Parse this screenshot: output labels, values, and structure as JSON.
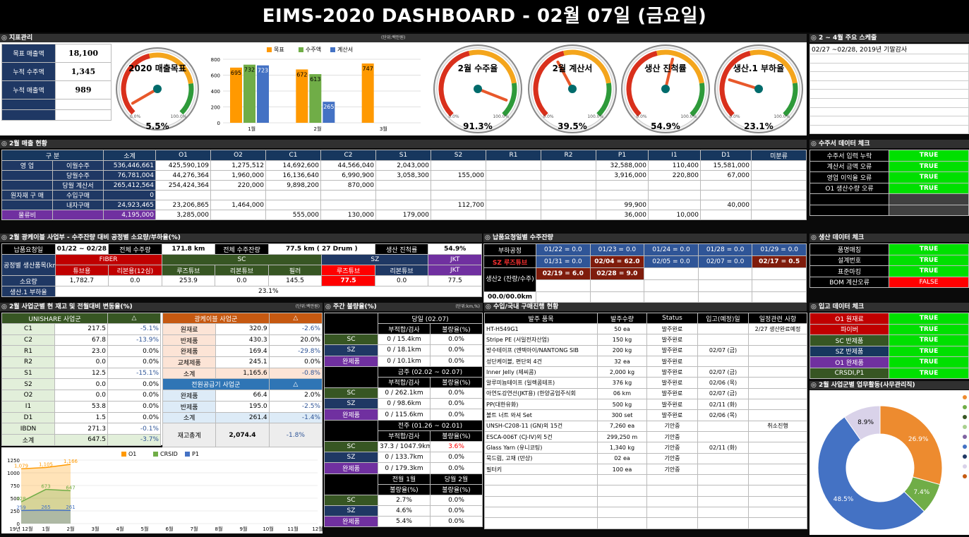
{
  "title": "EIMS-2020 DASHBOARD - 02월 07일 (금요일)",
  "sections": {
    "kpi": "◎ 지표관리",
    "schedule": "◎ 2 ~ 4월 주요 스케줄",
    "sales": "◎ 2월 매출 현황",
    "order_check": "◎ 수주서 데이터 체크",
    "cable": "◎ 2월 광케이블 사업부 - 수주잔량 대비 공정별 소요량/부하율(%)",
    "deadline": "◎ 납품요청일별 수주잔량",
    "prod_check": "◎ 생산 데이터 체크",
    "inventory": "◎ 2월 사업군별 현 재고 및 전월대비 변동율(%)",
    "defect": "◎ 주간 불량율(%)",
    "purchase": "◎ 수입/국내 구매진행 현황",
    "receipt_check": "◎ 입고 데이터 체크",
    "activity": "◎ 2월 사업군별 업무활동(사무관리직)"
  },
  "kpi": {
    "unit": "(단위:백만원)",
    "rows": [
      {
        "label": "목표 매출액",
        "value": "18,100"
      },
      {
        "label": "누적 수주액",
        "value": "1,345"
      },
      {
        "label": "누적 매출액",
        "value": "989"
      }
    ]
  },
  "gauges": [
    {
      "title": "2020 매출목표",
      "value": "5.5%",
      "pct": 5.5
    },
    {
      "title": "2월 수주율",
      "value": "91.3%",
      "pct": 91.3
    },
    {
      "title": "2월 계산서",
      "value": "39.5%",
      "pct": 39.5
    },
    {
      "title": "생산 진척률",
      "value": "54.9%",
      "pct": 54.9
    },
    {
      "title": "생산.1 부하율",
      "value": "23.1%",
      "pct": 23.1
    }
  ],
  "gauge_ticks": {
    "min": "0.0%",
    "max": "100.0%"
  },
  "chart_data": [
    {
      "type": "bar",
      "categories": [
        "1월",
        "2월",
        "3월"
      ],
      "series": [
        {
          "name": "목표",
          "color": "#ff9900",
          "values": [
            695,
            672,
            747
          ]
        },
        {
          "name": "수주액",
          "color": "#70ad47",
          "values": [
            732,
            613,
            null
          ]
        },
        {
          "name": "계산서",
          "color": "#4472c4",
          "values": [
            723,
            265,
            null
          ]
        }
      ],
      "ylim": [
        0,
        800
      ],
      "yticks": [
        "0",
        "200",
        "400",
        "600",
        "800"
      ]
    },
    {
      "type": "line",
      "categories": [
        "19년 12월",
        "1월",
        "2월",
        "3월",
        "4월",
        "5월",
        "6월",
        "7월",
        "8월",
        "9월",
        "10월",
        "11월",
        "12월"
      ],
      "series": [
        {
          "name": "O1",
          "color": "#ff9900",
          "values": [
            1079,
            1105,
            1166
          ]
        },
        {
          "name": "CRSID",
          "color": "#70ad47",
          "values": [
            428,
            673,
            647
          ]
        },
        {
          "name": "P1",
          "color": "#4472c4",
          "values": [
            259,
            265,
            261
          ]
        }
      ],
      "ylim": [
        0,
        1250
      ],
      "yticks": [
        "0",
        "250",
        "500",
        "750",
        "1000",
        "1250"
      ],
      "point_labels": [
        [
          "1,079",
          "1,105",
          "1,166"
        ],
        [
          "428",
          "673",
          "647"
        ],
        [
          "259",
          "265",
          "261"
        ]
      ]
    },
    {
      "type": "pie",
      "values": [
        26.9,
        7.4,
        48.5,
        8.9
      ],
      "labels": [
        "26.9%",
        "7.4%",
        "48.5%",
        "8.9%"
      ],
      "colors": [
        "#ed8b2f",
        "#70ad47",
        "#4472c4",
        "#d9d2e9"
      ]
    }
  ],
  "schedule": [
    "02/27 ~02/28, 2019년 기말감사",
    "",
    "",
    "",
    "",
    "",
    "",
    "",
    "",
    ""
  ],
  "sales": {
    "header": [
      "구 분",
      "소계",
      "O1",
      "O2",
      "C1",
      "C2",
      "S1",
      "S2",
      "R1",
      "R2",
      "P1",
      "I1",
      "D1",
      "미분류"
    ],
    "rows": [
      [
        "영 업",
        "이월수주",
        "536,446,661",
        "425,590,109",
        "1,275,512",
        "14,692,600",
        "44,566,040",
        "2,043,000",
        "",
        "",
        "",
        "32,588,000",
        "110,400",
        "15,581,000",
        ""
      ],
      [
        "",
        "당월수주",
        "76,781,004",
        "44,276,364",
        "1,960,000",
        "16,136,640",
        "6,990,900",
        "3,058,300",
        "155,000",
        "",
        "",
        "3,916,000",
        "220,800",
        "67,000",
        ""
      ],
      [
        "",
        "당월 계산서",
        "265,412,564",
        "254,424,364",
        "220,000",
        "9,898,200",
        "870,000",
        "",
        "",
        "",
        "",
        "",
        "",
        "",
        ""
      ],
      [
        "원자재 구 매",
        "수입구매",
        "0",
        "",
        "",
        "",
        "",
        "",
        "",
        "",
        "",
        "",
        "",
        "",
        ""
      ],
      [
        "",
        "내자구매",
        "24,923,465",
        "23,206,865",
        "1,464,000",
        "",
        "",
        "",
        "112,700",
        "",
        "",
        "99,900",
        "",
        "40,000",
        ""
      ],
      [
        "물류비",
        "",
        "4,195,000",
        "3,285,000",
        "",
        "555,000",
        "130,000",
        "179,000",
        "",
        "",
        "",
        "36,000",
        "10,000",
        "",
        ""
      ]
    ]
  },
  "order_check": [
    {
      "label": "수주서 입력 누락",
      "value": "TRUE"
    },
    {
      "label": "계산서 금액 오류",
      "value": "TRUE"
    },
    {
      "label": "영업 이익율 오류",
      "value": "TRUE"
    },
    {
      "label": "O1 생산수량 오류",
      "value": "TRUE"
    }
  ],
  "cable": {
    "r1": [
      "납품요청일",
      "01/22 ~ 02/28",
      "전체 수주량",
      "171.8 km",
      "전체 수주잔량",
      "77.5 km ( 27 Drum )",
      "생산 진척률",
      "54.9%"
    ],
    "groups": [
      "공정별 생산품목(km)",
      "FIBER",
      "SC",
      "SZ",
      "JKT"
    ],
    "items": [
      "튜브용",
      "리본용(12심)",
      "루즈튜브",
      "리본튜브",
      "필러",
      "루즈튜브",
      "리본튜브",
      "JKT"
    ],
    "usage_label": "소요량",
    "usage": [
      "1,782.7",
      "0.0",
      "253.9",
      "0.0",
      "145.5",
      "77.5",
      "0.0",
      "77.5"
    ],
    "load_label": "생산.1 부하율",
    "load": "23.1%"
  },
  "deadline": {
    "label1": "부하공정",
    "hl": "SZ 루즈튜브",
    "label2": "생산2 (잔량/수주)",
    "r1": [
      "01/22 = 0.0",
      "01/23 = 0.0",
      "01/24 = 0.0",
      "01/28 = 0.0",
      "01/29 = 0.0"
    ],
    "r2": [
      "01/31 = 0.0",
      "02/04 = 62.0",
      "02/05 = 0.0",
      "02/07 = 0.0",
      "02/17 = 0.5"
    ],
    "r3": [
      "02/19 = 6.0",
      "02/28 = 9.0"
    ],
    "foot": "00.0/00.0km"
  },
  "prod_check": [
    {
      "label": "품명매칭",
      "value": "TRUE"
    },
    {
      "label": "설계번호",
      "value": "TRUE"
    },
    {
      "label": "표준마킹",
      "value": "TRUE"
    },
    {
      "label": "BOM 계산오류",
      "value": "FALSE"
    }
  ],
  "inventory": {
    "unit": "(단위:백만원)",
    "left_head": [
      "UNISHARE 사업군",
      "△"
    ],
    "left": [
      [
        "C1",
        "217.5",
        "-5.1%"
      ],
      [
        "C2",
        "67.8",
        "-13.9%"
      ],
      [
        "R1",
        "23.0",
        "0.0%"
      ],
      [
        "R2",
        "0.0",
        "0.0%"
      ],
      [
        "S1",
        "12.5",
        "-15.1%"
      ],
      [
        "S2",
        "0.0",
        "0.0%"
      ],
      [
        "O2",
        "0.0",
        "0.0%"
      ],
      [
        "I1",
        "53.8",
        "0.0%"
      ],
      [
        "D1",
        "1.5",
        "0.0%"
      ],
      [
        "IBDN",
        "271.3",
        "-0.1%"
      ],
      [
        "소계",
        "647.5",
        "-3.7%"
      ]
    ],
    "mid_head": [
      "광케이블 사업군",
      "△"
    ],
    "mid": [
      [
        "원재료",
        "320.9",
        "-2.6%"
      ],
      [
        "반제품",
        "430.3",
        "20.0%"
      ],
      [
        "완제품",
        "169.4",
        "-29.8%"
      ],
      [
        "교체제품",
        "245.1",
        "0.0%"
      ],
      [
        "소계",
        "1,165.6",
        "-0.8%"
      ]
    ],
    "mid2_head": [
      "전원공급기 사업군",
      "△"
    ],
    "mid2": [
      [
        "완제품",
        "66.4",
        "2.0%"
      ],
      [
        "반제품",
        "195.0",
        "-2.5%"
      ],
      [
        "소계",
        "261.4",
        "-1.4%"
      ]
    ],
    "total": [
      "재고총계",
      "2,074.4",
      "-1.8%"
    ]
  },
  "defect": {
    "unit": "(단위:km,%)",
    "blocks": [
      {
        "title": "당일 (02.07)",
        "cols": [
          "부적합/검사",
          "불량율(%)"
        ],
        "rows": [
          [
            "SC",
            "0 / 15.4km",
            "0.0%"
          ],
          [
            "SZ",
            "0 / 18.1km",
            "0.0%"
          ],
          [
            "완제품",
            "0 / 10.1km",
            "0.0%"
          ]
        ]
      },
      {
        "title": "금주 (02.02 ~ 02.07)",
        "cols": [
          "부적합/검사",
          "불량율(%)"
        ],
        "rows": [
          [
            "SC",
            "0 / 262.1km",
            "0.0%"
          ],
          [
            "SZ",
            "0 / 98.6km",
            "0.0%"
          ],
          [
            "완제품",
            "0 / 115.6km",
            "0.0%"
          ]
        ]
      },
      {
        "title": "전주 (01.26 ~ 02.01)",
        "cols": [
          "부적합/검사",
          "불량율(%)"
        ],
        "rows": [
          [
            "SC",
            "37.3 / 1047.9km",
            "3.6%"
          ],
          [
            "SZ",
            "0 / 133.7km",
            "0.0%"
          ],
          [
            "완제품",
            "0 / 179.3km",
            "0.0%"
          ]
        ]
      }
    ],
    "month_head": [
      "전월 1월",
      "당월 2월"
    ],
    "month_cols": [
      "불량율(%)",
      "불량율(%)"
    ],
    "month": [
      [
        "SC",
        "2.7%",
        "0.0%"
      ],
      [
        "SZ",
        "4.6%",
        "0.0%"
      ],
      [
        "완제품",
        "5.4%",
        "0.0%"
      ]
    ]
  },
  "purchase": {
    "head": [
      "발주 품목",
      "발주수량",
      "Status",
      "입고(예정)일",
      "일정관련 사항"
    ],
    "rows": [
      [
        "HT-H549G1",
        "50 ea",
        "발주완료",
        "",
        "2/27 생산완료예정"
      ],
      [
        "Stripe PE (서일전자산업)",
        "150 kg",
        "발주완료",
        "",
        ""
      ],
      [
        "방수테이프 (엔텍아이/NANTONG SIB",
        "200 kg",
        "발주완료",
        "02/07 (금)",
        ""
      ],
      [
        "성단케이블, 편단외 4건",
        "32 ea",
        "발주완료",
        "",
        ""
      ],
      [
        "Inner Jelly (제씨콤)",
        "2,000 kg",
        "발주완료",
        "02/07 (금)",
        ""
      ],
      [
        "알루미늄테이프 (일렉콤테프)",
        "376 kg",
        "발주완료",
        "02/06 (목)",
        ""
      ],
      [
        "아연도강연선(JKT용) (한양공업주식회",
        "06 km",
        "발주완료",
        "02/07 (금)",
        ""
      ],
      [
        "PP(대한유화)",
        "500 kg",
        "발주완료",
        "02/11 (화)",
        ""
      ],
      [
        "볼트 너트 와셔 Set",
        "300 set",
        "발주완료",
        "02/06 (목)",
        ""
      ],
      [
        "UNSH-C208-11 (GN)외 15건",
        "7,260 ea",
        "기안중",
        "",
        "취소진행"
      ],
      [
        "ESCA-006T (CJ-IV)외 5건",
        "299,250 m",
        "기안중",
        "",
        ""
      ],
      [
        "Glass Yarn (유니코팅)",
        "1,340 kg",
        "기안중",
        "02/11 (화)",
        ""
      ],
      [
        "묵드럼, 고재 (만상)",
        "02 ea",
        "기안중",
        "",
        ""
      ],
      [
        "필터키",
        "100 ea",
        "기안중",
        "",
        ""
      ],
      [
        "",
        "",
        "",
        "",
        ""
      ],
      [
        "",
        "",
        "",
        "",
        ""
      ],
      [
        "",
        "",
        "",
        "",
        ""
      ],
      [
        "",
        "",
        "",
        "",
        ""
      ],
      [
        "",
        "",
        "",
        "",
        ""
      ]
    ]
  },
  "receipt_check": [
    {
      "label": "O1 원재료",
      "value": "TRUE",
      "bg": "#c00000"
    },
    {
      "label": "파이버",
      "value": "TRUE",
      "bg": "#c00000"
    },
    {
      "label": "SC 반제품",
      "value": "TRUE",
      "bg": "#375623"
    },
    {
      "label": "SZ 반제품",
      "value": "TRUE",
      "bg": "#17375e"
    },
    {
      "label": "O1 완제품",
      "value": "TRUE",
      "bg": "#7030a0"
    },
    {
      "label": "CRSDI,P1",
      "value": "TRUE",
      "bg": "#375623"
    }
  ]
}
